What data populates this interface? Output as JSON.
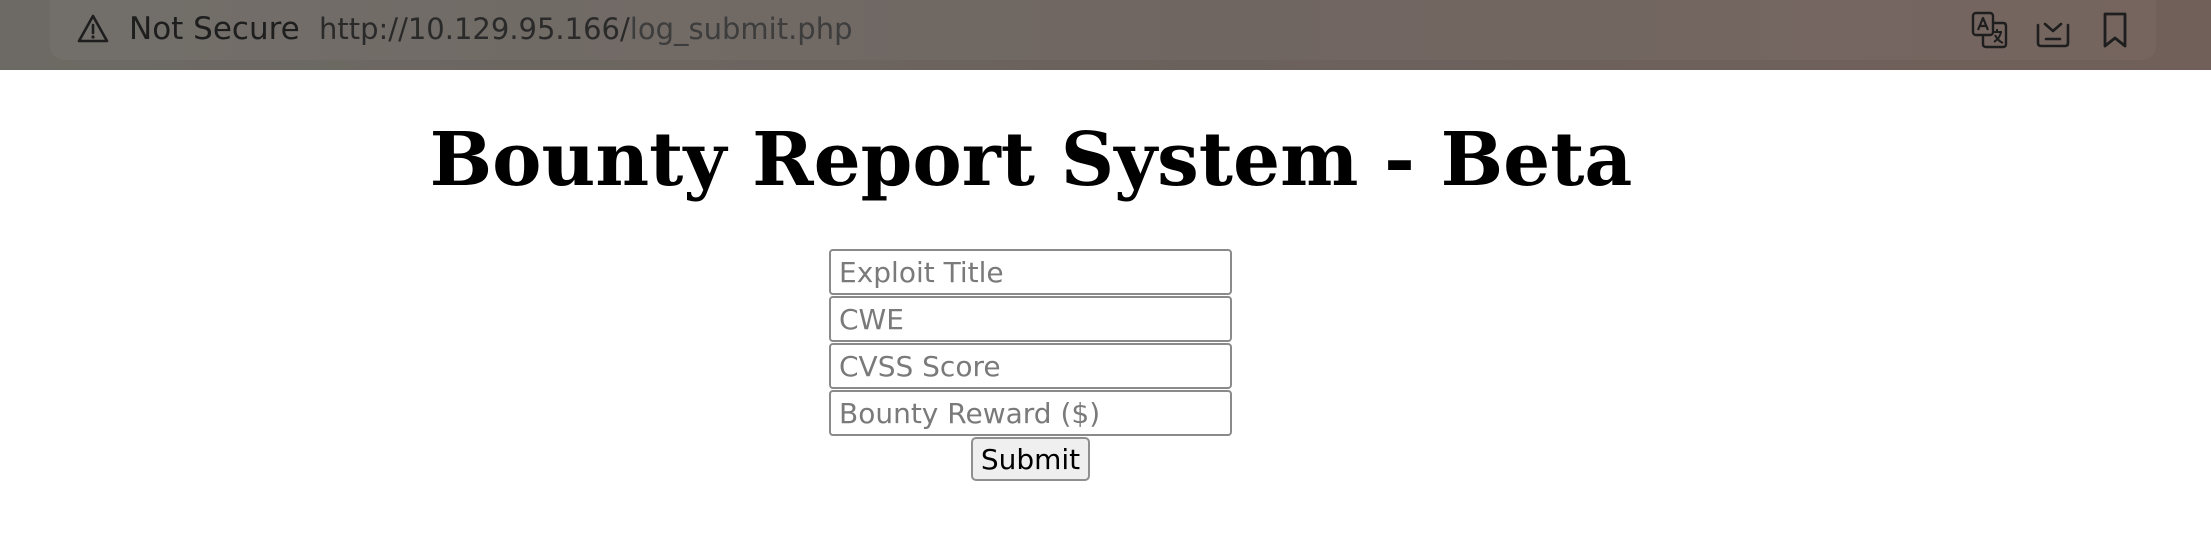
{
  "browser": {
    "security_label": "Not Secure",
    "url_host": "http://10.129.95.166/",
    "url_path": "log_submit.php",
    "icons": [
      "warning-icon",
      "translate-icon",
      "download-icon",
      "bookmark-icon"
    ]
  },
  "page": {
    "title": "Bounty Report System - Beta"
  },
  "form": {
    "fields": [
      {
        "name": "exploit-title",
        "placeholder": "Exploit Title",
        "value": ""
      },
      {
        "name": "cwe",
        "placeholder": "CWE",
        "value": ""
      },
      {
        "name": "cvss-score",
        "placeholder": "CVSS Score",
        "value": ""
      },
      {
        "name": "bounty-reward",
        "placeholder": "Bounty Reward ($)",
        "value": ""
      }
    ],
    "submit_label": "Submit"
  },
  "colors": {
    "toolbar": "#6b635e",
    "page_background": "#ffffff",
    "input_border": "#8a8a8a",
    "button_background": "#efefef"
  }
}
